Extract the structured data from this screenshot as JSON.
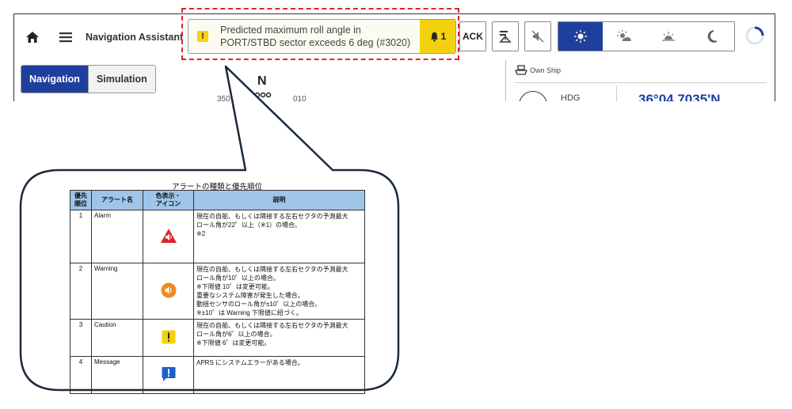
{
  "app": {
    "title": "Navigation Assistant",
    "alert": {
      "message": "Predicted maximum roll angle in PORT/STBD sector exceeds 6 deg (#3020)",
      "caution_symbol": "!",
      "bell_count": "1"
    },
    "ack_label": "ACK",
    "tabs": [
      {
        "label": "Navigation",
        "active": true
      },
      {
        "label": "Simulation",
        "active": false
      }
    ],
    "compass": {
      "north": "N",
      "left_tick": "350",
      "right_tick": "010"
    },
    "own_ship": {
      "label": "Own Ship",
      "hdg_label": "HDG",
      "latitude": "36°04.7035'N"
    },
    "colors": {
      "accent": "#1f3f9d",
      "alert_yellow": "#f2d20e",
      "highlight_red": "#d9252a",
      "table_header": "#9fc5e8"
    }
  },
  "table": {
    "title": "アラートの種類と優先順位",
    "headers": {
      "priority": [
        "優先",
        "順位"
      ],
      "name": "アラート名",
      "icon": [
        "色表示・",
        "アイコン"
      ],
      "description": "説明"
    },
    "rows": [
      {
        "priority": "1",
        "name": "Alarm",
        "icon": "red-triangle-speaker-icon",
        "description": [
          "現在の自船、もしくは隣接する左右セクタの予測最大",
          "ロール角が22゜以上（※1）の場合。",
          "※2"
        ]
      },
      {
        "priority": "2",
        "name": "Warning",
        "icon": "orange-circle-speaker-icon",
        "description": [
          "現在の自船、もしくは隣接する左右セクタの予測最大",
          "ロール角が10゜以上の場合。",
          "※下限値 10゜は変更可能。",
          "重要なシステム障害が発生した場合。",
          "動揺センサのロール角が±10゜以上の場合。",
          "※±10゜は Warning 下限値に紐づく。"
        ]
      },
      {
        "priority": "3",
        "name": "Caution",
        "icon": "yellow-square-exclamation-icon",
        "description": [
          "現在の自船、もしくは隣接する左右セクタの予測最大",
          "ロール角が6゜以上の場合。",
          "※下限値 6゜は変更可能。"
        ]
      },
      {
        "priority": "4",
        "name": "Message",
        "icon": "blue-speech-exclamation-icon",
        "description": [
          "APRS にシステムエラーがある場合。"
        ]
      }
    ]
  }
}
